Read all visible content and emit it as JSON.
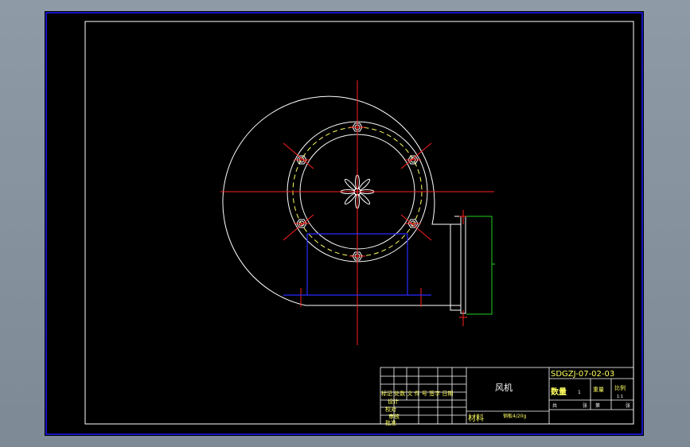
{
  "title_block": {
    "drawing_number": "SDGZJ-07-02-03",
    "part_name": "风机",
    "quantity_label": "数量",
    "quantity_value": "1",
    "weight_label": "重量",
    "scale_label": "比例",
    "scale_value": "1:1",
    "sheet_total_label": "共",
    "sheet_unit_1": "张",
    "sheet_index_label": "第",
    "sheet_unit_2": "张",
    "rev_headers": "标记 处数 文 件 号 签字 日期",
    "role_design": "设计",
    "role_check": "校对",
    "role_review": "审核",
    "role_approve": "批准",
    "material_label": "材料",
    "material_value": "钢板4/20g"
  },
  "colors": {
    "background": "#000000",
    "frame": "#1a1aff",
    "outline": "#ffffff",
    "centerline": "#ff2020",
    "hidden": "#2a2aff",
    "dash_circle": "#ffff60",
    "bracket": "#20d020",
    "title_text": "#ffff60"
  }
}
